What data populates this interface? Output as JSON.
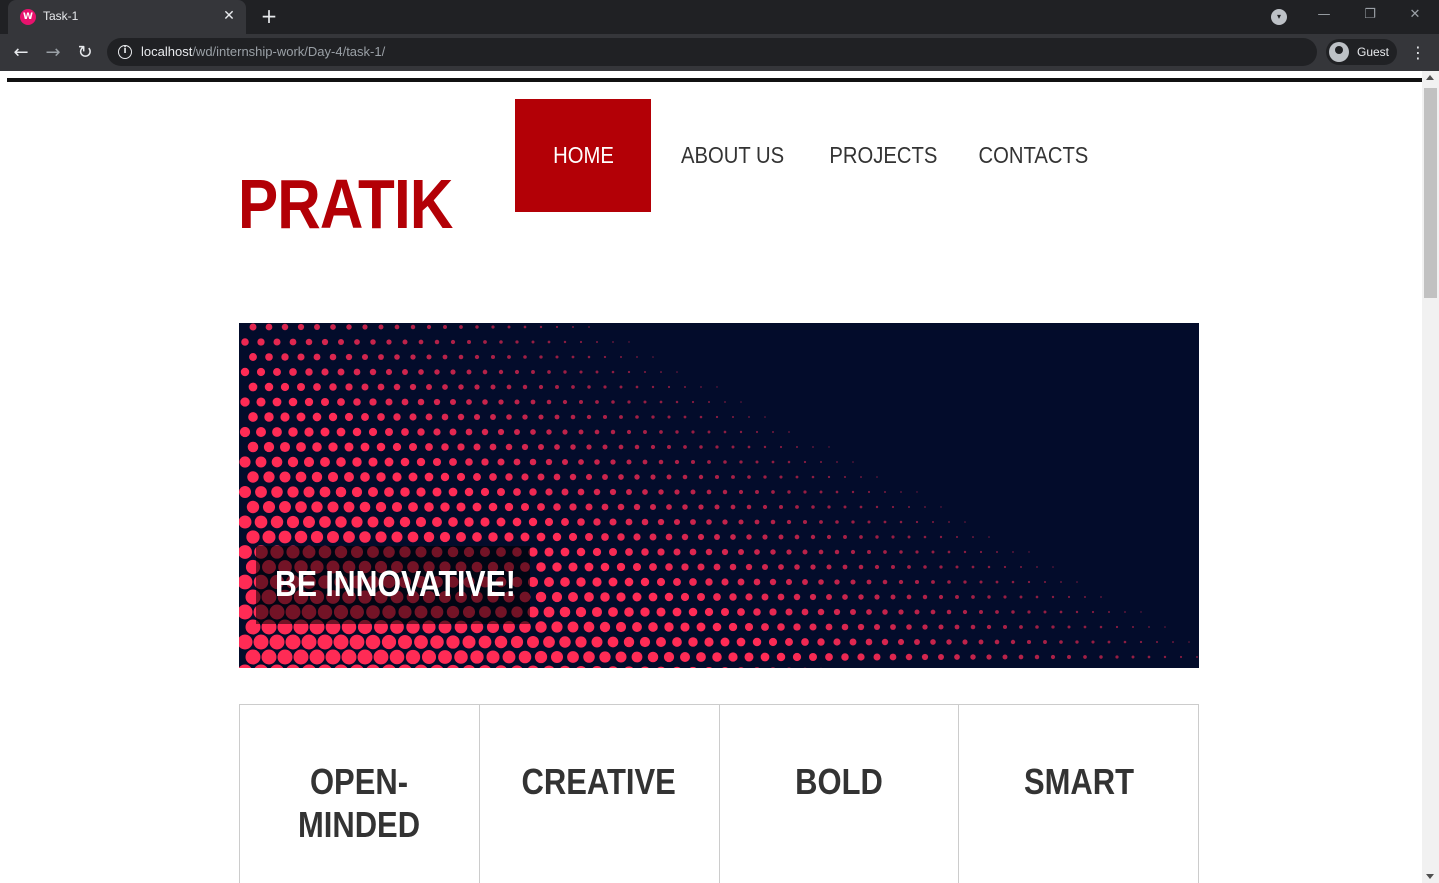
{
  "browser": {
    "tab_title": "Task-1",
    "favicon_glyph": "W",
    "new_tab_glyph": "+",
    "close_glyph": "✕",
    "url_host": "localhost",
    "url_path": "/wd/internship-work/Day-4/task-1/",
    "profile_label": "Guest",
    "icons": [
      "back-arrow-icon",
      "forward-arrow-icon",
      "reload-icon",
      "info-icon",
      "profile-icon",
      "menu-dots-icon"
    ]
  },
  "site": {
    "logo": "PRATIK",
    "nav": [
      {
        "label": "HOME",
        "active": true
      },
      {
        "label": "ABOUT US",
        "active": false
      },
      {
        "label": "PROJECTS",
        "active": false
      },
      {
        "label": "CONTACTS",
        "active": false
      }
    ],
    "hero": {
      "caption": "BE INNOVATIVE!"
    },
    "features": [
      {
        "title": "OPEN-\nMINDED"
      },
      {
        "title": "CREATIVE"
      },
      {
        "title": "BOLD"
      },
      {
        "title": "SMART"
      }
    ]
  },
  "colors": {
    "brand_red": "#b30006",
    "hero_bg": "#030c2b",
    "dot_red": "#ff2b55"
  }
}
